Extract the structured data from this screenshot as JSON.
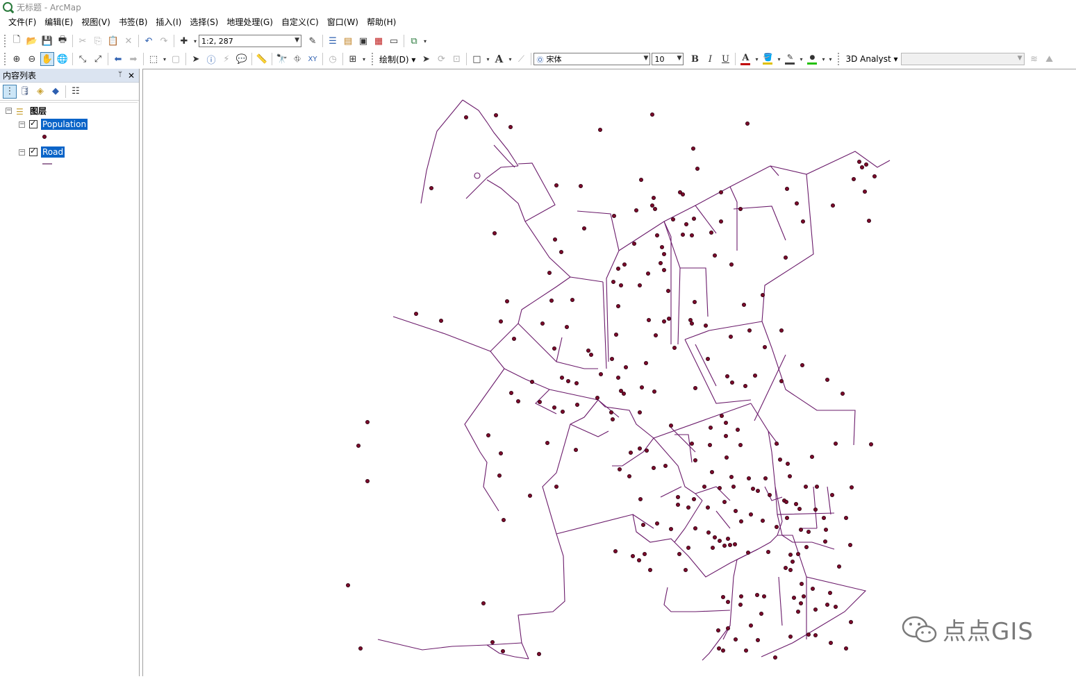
{
  "window": {
    "title": "无标题 - ArcMap"
  },
  "menu": [
    "文件(F)",
    "编辑(E)",
    "视图(V)",
    "书签(B)",
    "插入(I)",
    "选择(S)",
    "地理处理(G)",
    "自定义(C)",
    "窗口(W)",
    "帮助(H)"
  ],
  "toolbar": {
    "scale": "1:2, 287",
    "draw_label": "绘制(D)",
    "font_name": "宋体",
    "font_size": "10",
    "bold": "B",
    "italic": "I",
    "underline": "U",
    "font_color_glyph": "A",
    "analyst_label": "3D Analyst",
    "colors": {
      "font": "#c00000",
      "fill": "#e0c000",
      "line": "#404040",
      "marker": "#22c000"
    }
  },
  "toc": {
    "title": "内容列表",
    "pin": "📌",
    "close": "✕",
    "group": "图层",
    "layers": [
      {
        "name": "Population",
        "symbol": "point",
        "color": "#7a0a2a"
      },
      {
        "name": "Road",
        "symbol": "line",
        "color": "#5a1a5a"
      }
    ]
  },
  "map": {
    "road_color": "#6a1a6a",
    "point_color": "#7a0a2a",
    "point_outline": "#2a0010"
  },
  "watermark": {
    "text": "点点GIS"
  }
}
